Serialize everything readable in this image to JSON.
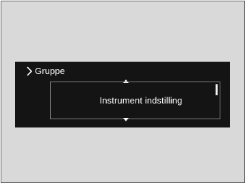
{
  "menu": {
    "breadcrumb_label": "Gruppe",
    "breadcrumb_icon": "chevron-right-icon",
    "selected_item": "Instrument indstilling",
    "up_icon": "chevron-up-icon",
    "down_icon": "chevron-down-icon",
    "scroll_position_fraction": 0.0
  },
  "colors": {
    "screen_background": "#141414",
    "text": "#ffffff",
    "frame_background": "#d9d9d9",
    "item_border": "#8a8a8a"
  }
}
